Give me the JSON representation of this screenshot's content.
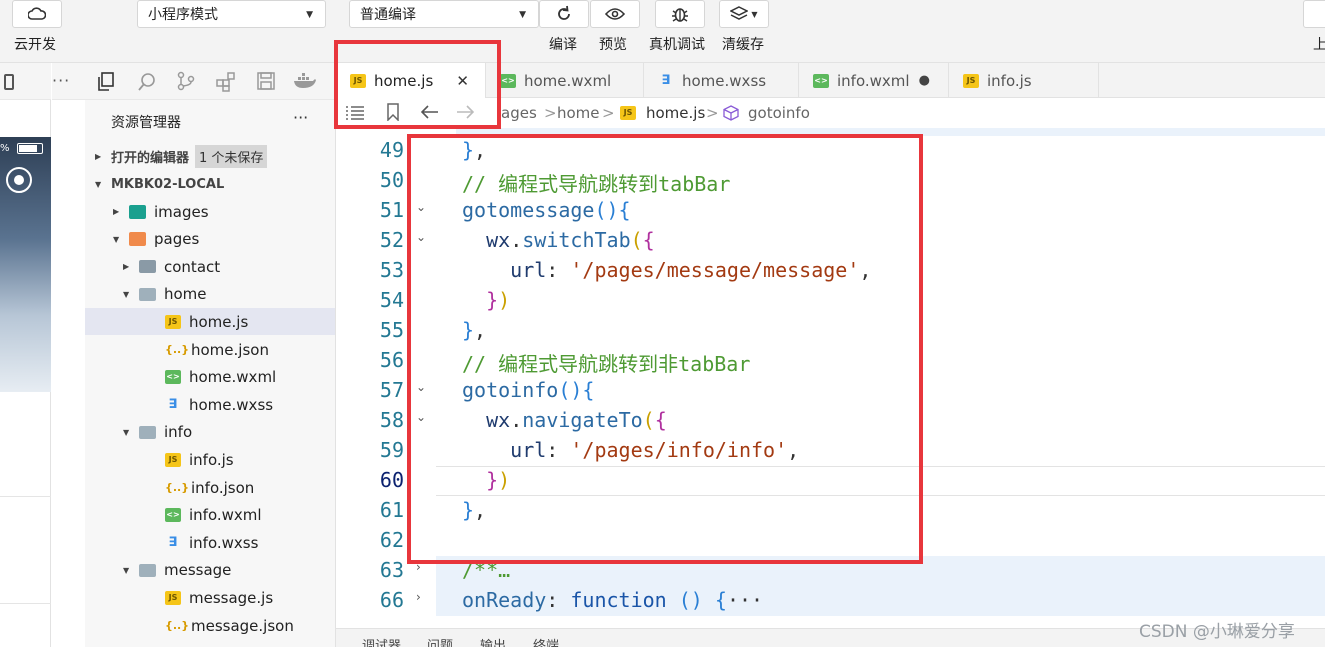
{
  "toolbar": {
    "cloud_label": "云开发",
    "mode_select": "小程序模式",
    "compile_select": "普通编译",
    "compile_label": "编译",
    "preview_label": "预览",
    "debug_label": "真机调试",
    "cache_label": "清缓存",
    "right_label": "上"
  },
  "explorer": {
    "title": "资源管理器",
    "more": "···",
    "open_editors": "打开的编辑器",
    "unsaved_badge": "1 个未保存",
    "project": "MKBK02-LOCAL",
    "tree": [
      {
        "label": "images",
        "type": "img",
        "indent": 1,
        "arrow": "▶"
      },
      {
        "label": "pages",
        "type": "pages",
        "indent": 1,
        "arrow": "▼"
      },
      {
        "label": "contact",
        "type": "folder",
        "indent": 2,
        "arrow": "▶"
      },
      {
        "label": "home",
        "type": "folder-open",
        "indent": 2,
        "arrow": "▼"
      },
      {
        "label": "home.js",
        "type": "js",
        "indent": 3,
        "arrow": "",
        "selected": true
      },
      {
        "label": "home.json",
        "type": "json",
        "indent": 3,
        "arrow": ""
      },
      {
        "label": "home.wxml",
        "type": "wxml",
        "indent": 3,
        "arrow": ""
      },
      {
        "label": "home.wxss",
        "type": "wxss",
        "indent": 3,
        "arrow": ""
      },
      {
        "label": "info",
        "type": "folder-open",
        "indent": 2,
        "arrow": "▼"
      },
      {
        "label": "info.js",
        "type": "js",
        "indent": 3,
        "arrow": ""
      },
      {
        "label": "info.json",
        "type": "json",
        "indent": 3,
        "arrow": ""
      },
      {
        "label": "info.wxml",
        "type": "wxml",
        "indent": 3,
        "arrow": ""
      },
      {
        "label": "info.wxss",
        "type": "wxss",
        "indent": 3,
        "arrow": ""
      },
      {
        "label": "message",
        "type": "folder-open",
        "indent": 2,
        "arrow": "▼"
      },
      {
        "label": "message.js",
        "type": "js",
        "indent": 3,
        "arrow": ""
      },
      {
        "label": "message.json",
        "type": "json",
        "indent": 3,
        "arrow": ""
      }
    ]
  },
  "tabs": [
    {
      "label": "home.js",
      "icon": "js",
      "active": true,
      "close": "✕"
    },
    {
      "label": "home.wxml",
      "icon": "wxml"
    },
    {
      "label": "home.wxss",
      "icon": "wxss"
    },
    {
      "label": "info.wxml",
      "icon": "wxml",
      "dirty": "●"
    },
    {
      "label": "info.js",
      "icon": "js"
    }
  ],
  "breadcrumb": {
    "seg1": "ages",
    "seg2": "home",
    "seg3": "home.js",
    "seg4": "gotoinfo",
    "sep": ">"
  },
  "code_lines": [
    {
      "n": "49",
      "html": "<span class=\"c-br3\">}</span>,",
      "fold": ""
    },
    {
      "n": "50",
      "html": "<span class=\"c-comment\">// 编程式导航跳转到tabBar</span>",
      "fold": ""
    },
    {
      "n": "51",
      "html": "<span class=\"c-func\">gotomessage</span><span class=\"c-br3\">(){</span>",
      "fold": "⌄"
    },
    {
      "n": "52",
      "html": "  <span class=\"c-prop\">wx</span>.<span class=\"c-func\">switchTab</span><span class=\"c-br1\">(</span><span class=\"c-br2\">{</span>",
      "fold": "⌄"
    },
    {
      "n": "53",
      "html": "    <span class=\"c-prop\">url</span>: <span class=\"c-str\">'/pages/message/message'</span>,",
      "fold": ""
    },
    {
      "n": "54",
      "html": "  <span class=\"c-br2\">}</span><span class=\"c-br1\">)</span>",
      "fold": ""
    },
    {
      "n": "55",
      "html": "<span class=\"c-br3\">}</span>,",
      "fold": ""
    },
    {
      "n": "56",
      "html": "<span class=\"c-comment\">// 编程式导航跳转到非tabBar</span>",
      "fold": ""
    },
    {
      "n": "57",
      "html": "<span class=\"c-func\">gotoinfo</span><span class=\"c-br3\">(){</span>",
      "fold": "⌄"
    },
    {
      "n": "58",
      "html": "  <span class=\"c-prop\">wx</span>.<span class=\"c-func\">navigateTo</span><span class=\"c-br1\">(</span><span class=\"c-br2\">{</span>",
      "fold": "⌄"
    },
    {
      "n": "59",
      "html": "    <span class=\"c-prop\">url</span>: <span class=\"c-str\">'/pages/info/info'</span>,",
      "fold": ""
    },
    {
      "n": "60",
      "html": "  <span class=\"c-br2\">}</span><span class=\"c-br1\">)</span>",
      "fold": ""
    },
    {
      "n": "61",
      "html": "<span class=\"c-br3\">}</span>,",
      "fold": ""
    },
    {
      "n": "62",
      "html": "",
      "fold": ""
    },
    {
      "n": "63",
      "html": "<span class=\"c-comment\">/**…</span>",
      "fold": "›"
    },
    {
      "n": "66",
      "html": "<span class=\"c-func\">onReady</span>: <span class=\"c-kw\">function</span> <span class=\"c-br3\">()</span> <span class=\"c-br3\">{</span>···",
      "fold": "›"
    }
  ],
  "bottom": {
    "tab1": "调试器",
    "tab2": "问题",
    "tab3": "输出",
    "tab4": "终端"
  },
  "watermark": "CSDN @小琳爱分享",
  "preview": {
    "battery": "%"
  }
}
